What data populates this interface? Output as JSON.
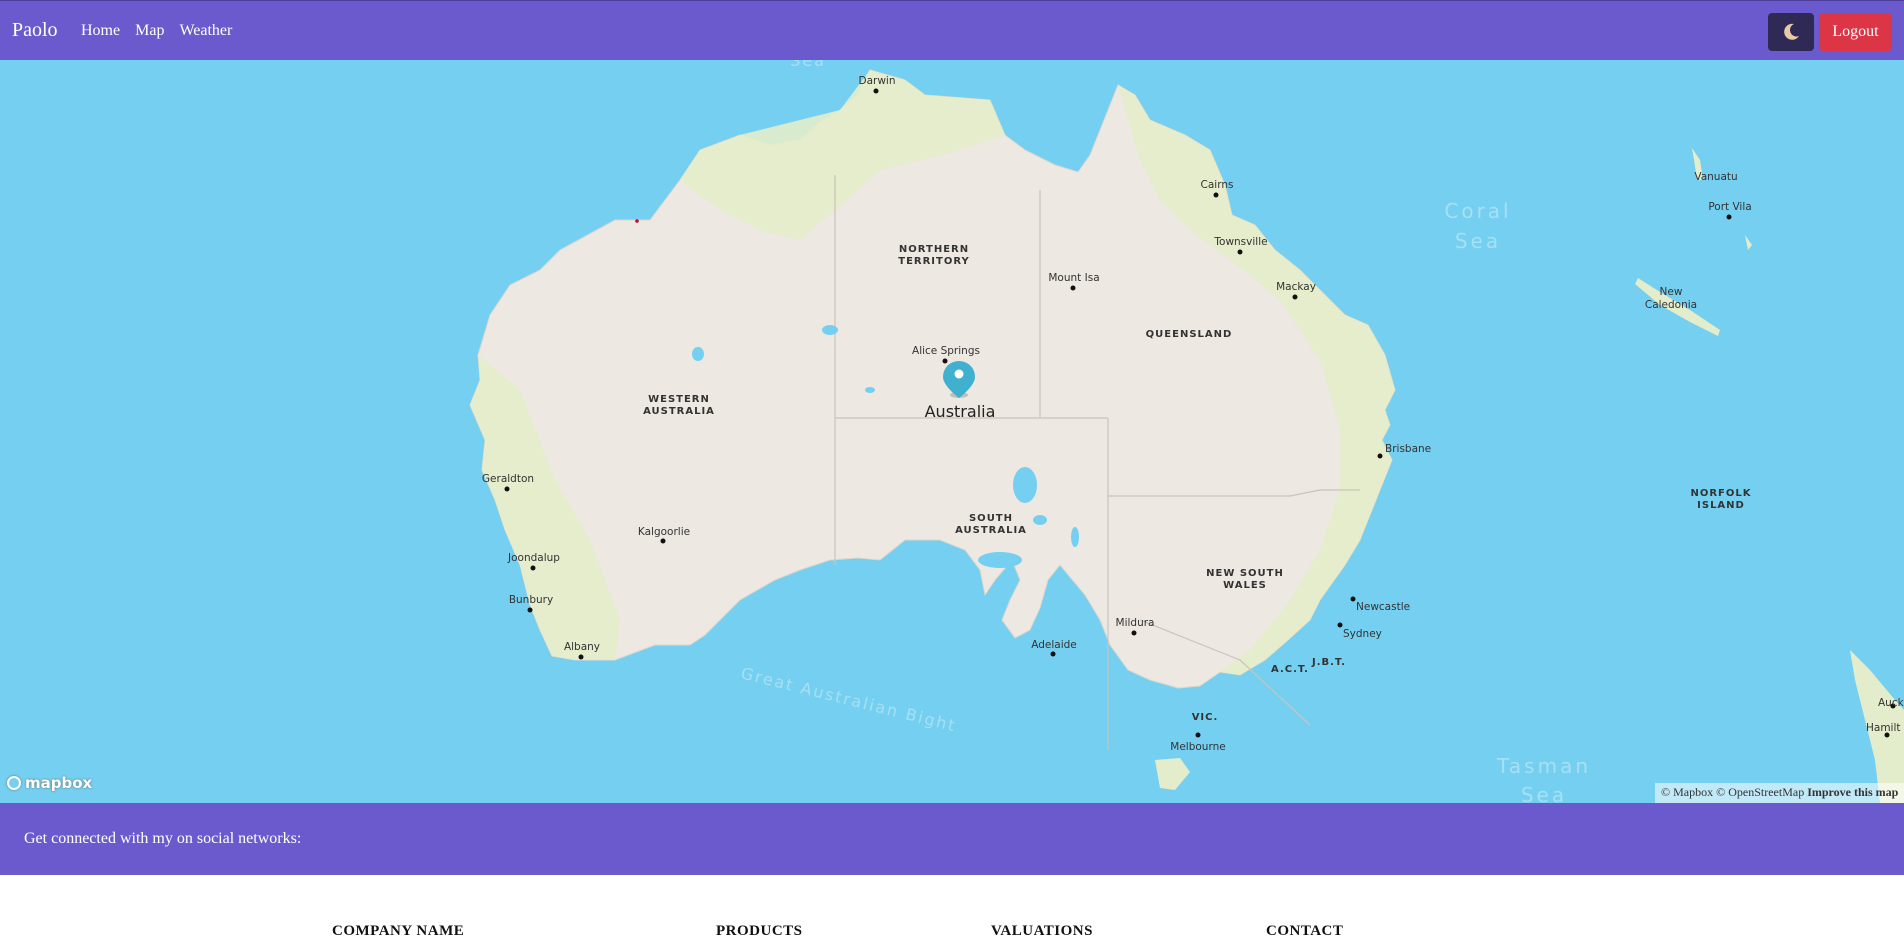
{
  "navbar": {
    "brand": "Paolo",
    "links": [
      "Home",
      "Map",
      "Weather"
    ],
    "theme_icon": "moon-icon",
    "logout_label": "Logout"
  },
  "map": {
    "marker_label": "Australia",
    "regions": {
      "nt_1": "NORTHERN",
      "nt_2": "TERRITORY",
      "wa_1": "WESTERN",
      "wa_2": "AUSTRALIA",
      "qld": "QUEENSLAND",
      "sa_1": "SOUTH",
      "sa_2": "AUSTRALIA",
      "nsw_1": "NEW SOUTH",
      "nsw_2": "WALES",
      "act": "A.C.T.",
      "jbt": "J.B.T.",
      "vic": "VIC.",
      "norfolk_1": "NORFOLK",
      "norfolk_2": "ISLAND"
    },
    "cities": {
      "darwin": "Darwin",
      "cairns": "Cairns",
      "townsville": "Townsville",
      "mackay": "Mackay",
      "mount_isa": "Mount Isa",
      "alice_springs": "Alice Springs",
      "brisbane": "Brisbane",
      "geraldton": "Geraldton",
      "kalgoorlie": "Kalgoorlie",
      "joondalup": "Joondalup",
      "bunbury": "Bunbury",
      "albany": "Albany",
      "adelaide": "Adelaide",
      "mildura": "Mildura",
      "newcastle": "Newcastle",
      "sydney": "Sydney",
      "melbourne": "Melbourne",
      "vanuatu": "Vanuatu",
      "port_vila": "Port Vila",
      "new_caledonia_1": "New",
      "new_caledonia_2": "Caledonia",
      "auckland": "Auckl",
      "hamilton": "Hamilt"
    },
    "seas": {
      "coral_1": "Coral",
      "coral_2": "Sea",
      "bight": "Great Australian Bight",
      "tasman_1": "Tasman",
      "tasman_2": "Sea",
      "top_sea": "Sea"
    },
    "logo_text": "mapbox",
    "attribution": {
      "copyright": "© Mapbox © OpenStreetMap",
      "improve": "Improve this map"
    },
    "colors": {
      "water": "#75cff0",
      "land": "#ede8e2",
      "vegetation": "#e4edcb",
      "marker": "#3fb1ce"
    }
  },
  "social": {
    "text": "Get connected with my on social networks:"
  },
  "footer": {
    "headings": [
      "COMPANY NAME",
      "PRODUCTS",
      "VALUATIONS",
      "CONTACT"
    ]
  }
}
